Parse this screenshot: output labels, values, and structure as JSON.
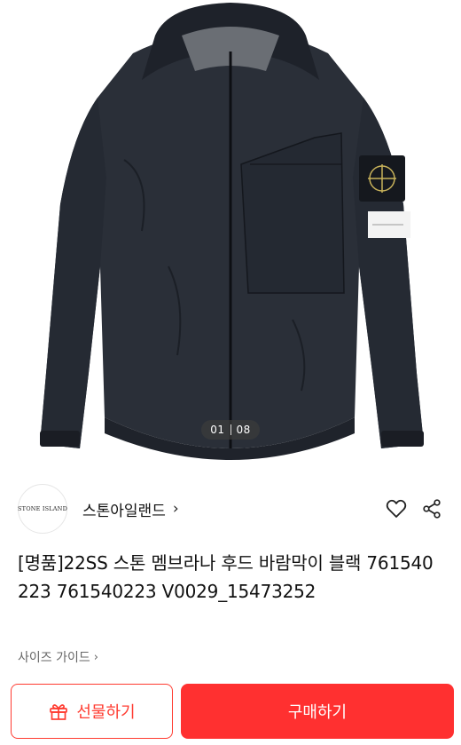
{
  "product_image": {
    "counter_current": "01",
    "counter_total": "08",
    "colors": {
      "jacket": "#2a2f38",
      "jacket_dark": "#1a1d24",
      "background": "#ffffff"
    }
  },
  "brand": {
    "logo_text": "STONE ISLAND",
    "name": "스톤아일랜드",
    "chevron": "›"
  },
  "product": {
    "title": "[명품]22SS 스톤 멤브라나 후드 바람막이 블랙 761540223 761540223 V0029_15473252",
    "size_guide": "사이즈 가이드",
    "size_guide_chevron": "›"
  },
  "actions": {
    "gift_label": "선물하기",
    "buy_label": "구매하기",
    "accent_color": "#ff3030"
  },
  "icons": {
    "favorite": "heart-icon",
    "share": "share-icon",
    "gift": "gift-icon"
  }
}
